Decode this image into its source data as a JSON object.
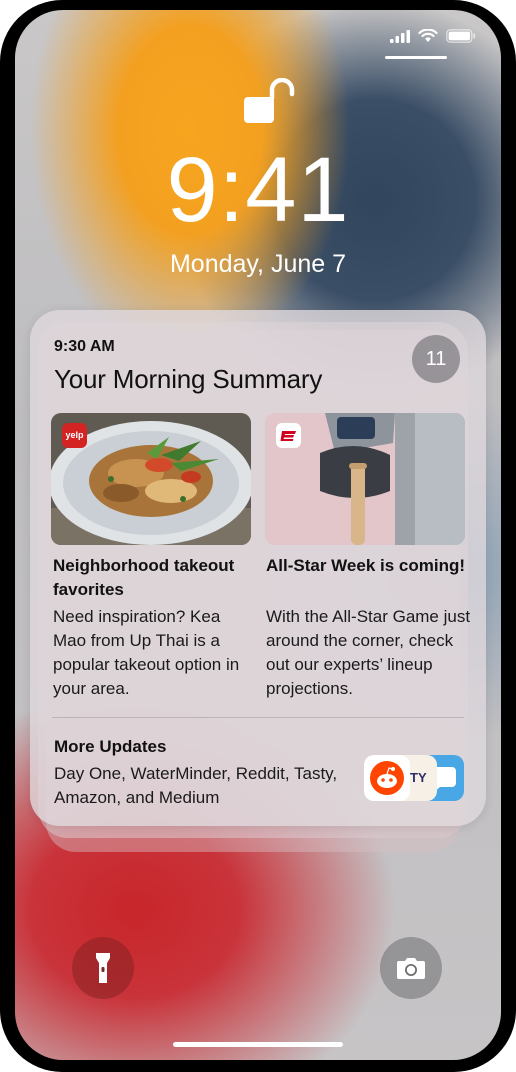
{
  "lock_screen": {
    "time": "9:41",
    "date": "Monday, June 7"
  },
  "summary": {
    "time": "9:30 AM",
    "title": "Your Morning Summary",
    "count": "11",
    "items": [
      {
        "app": "Yelp",
        "title": "Neighborhood takeout favorites",
        "body": "Need inspiration? Kea Mao from Up Thai is a popular takeout option in your area."
      },
      {
        "app": "ESPN",
        "title": "All-Star Week is coming!",
        "body": "With the All-Star Game just around the corner, check out our experts’ lineup projections."
      }
    ],
    "more": {
      "title": "More Updates",
      "body": "Day One, WaterMinder, Reddit, Tasty, Amazon, and Medium"
    },
    "thumb_labels": {
      "yelp": "yelp",
      "tasty": "STY"
    }
  },
  "colors": {
    "yelp_red": "#d32323",
    "espn_red": "#d0021b",
    "reddit_orange": "#ff4500",
    "waterminder_blue": "#4aa7e6"
  },
  "icons": [
    "cellular-signal-icon",
    "wifi-icon",
    "battery-icon",
    "unlocked-padlock-icon",
    "flashlight-icon",
    "camera-icon"
  ]
}
